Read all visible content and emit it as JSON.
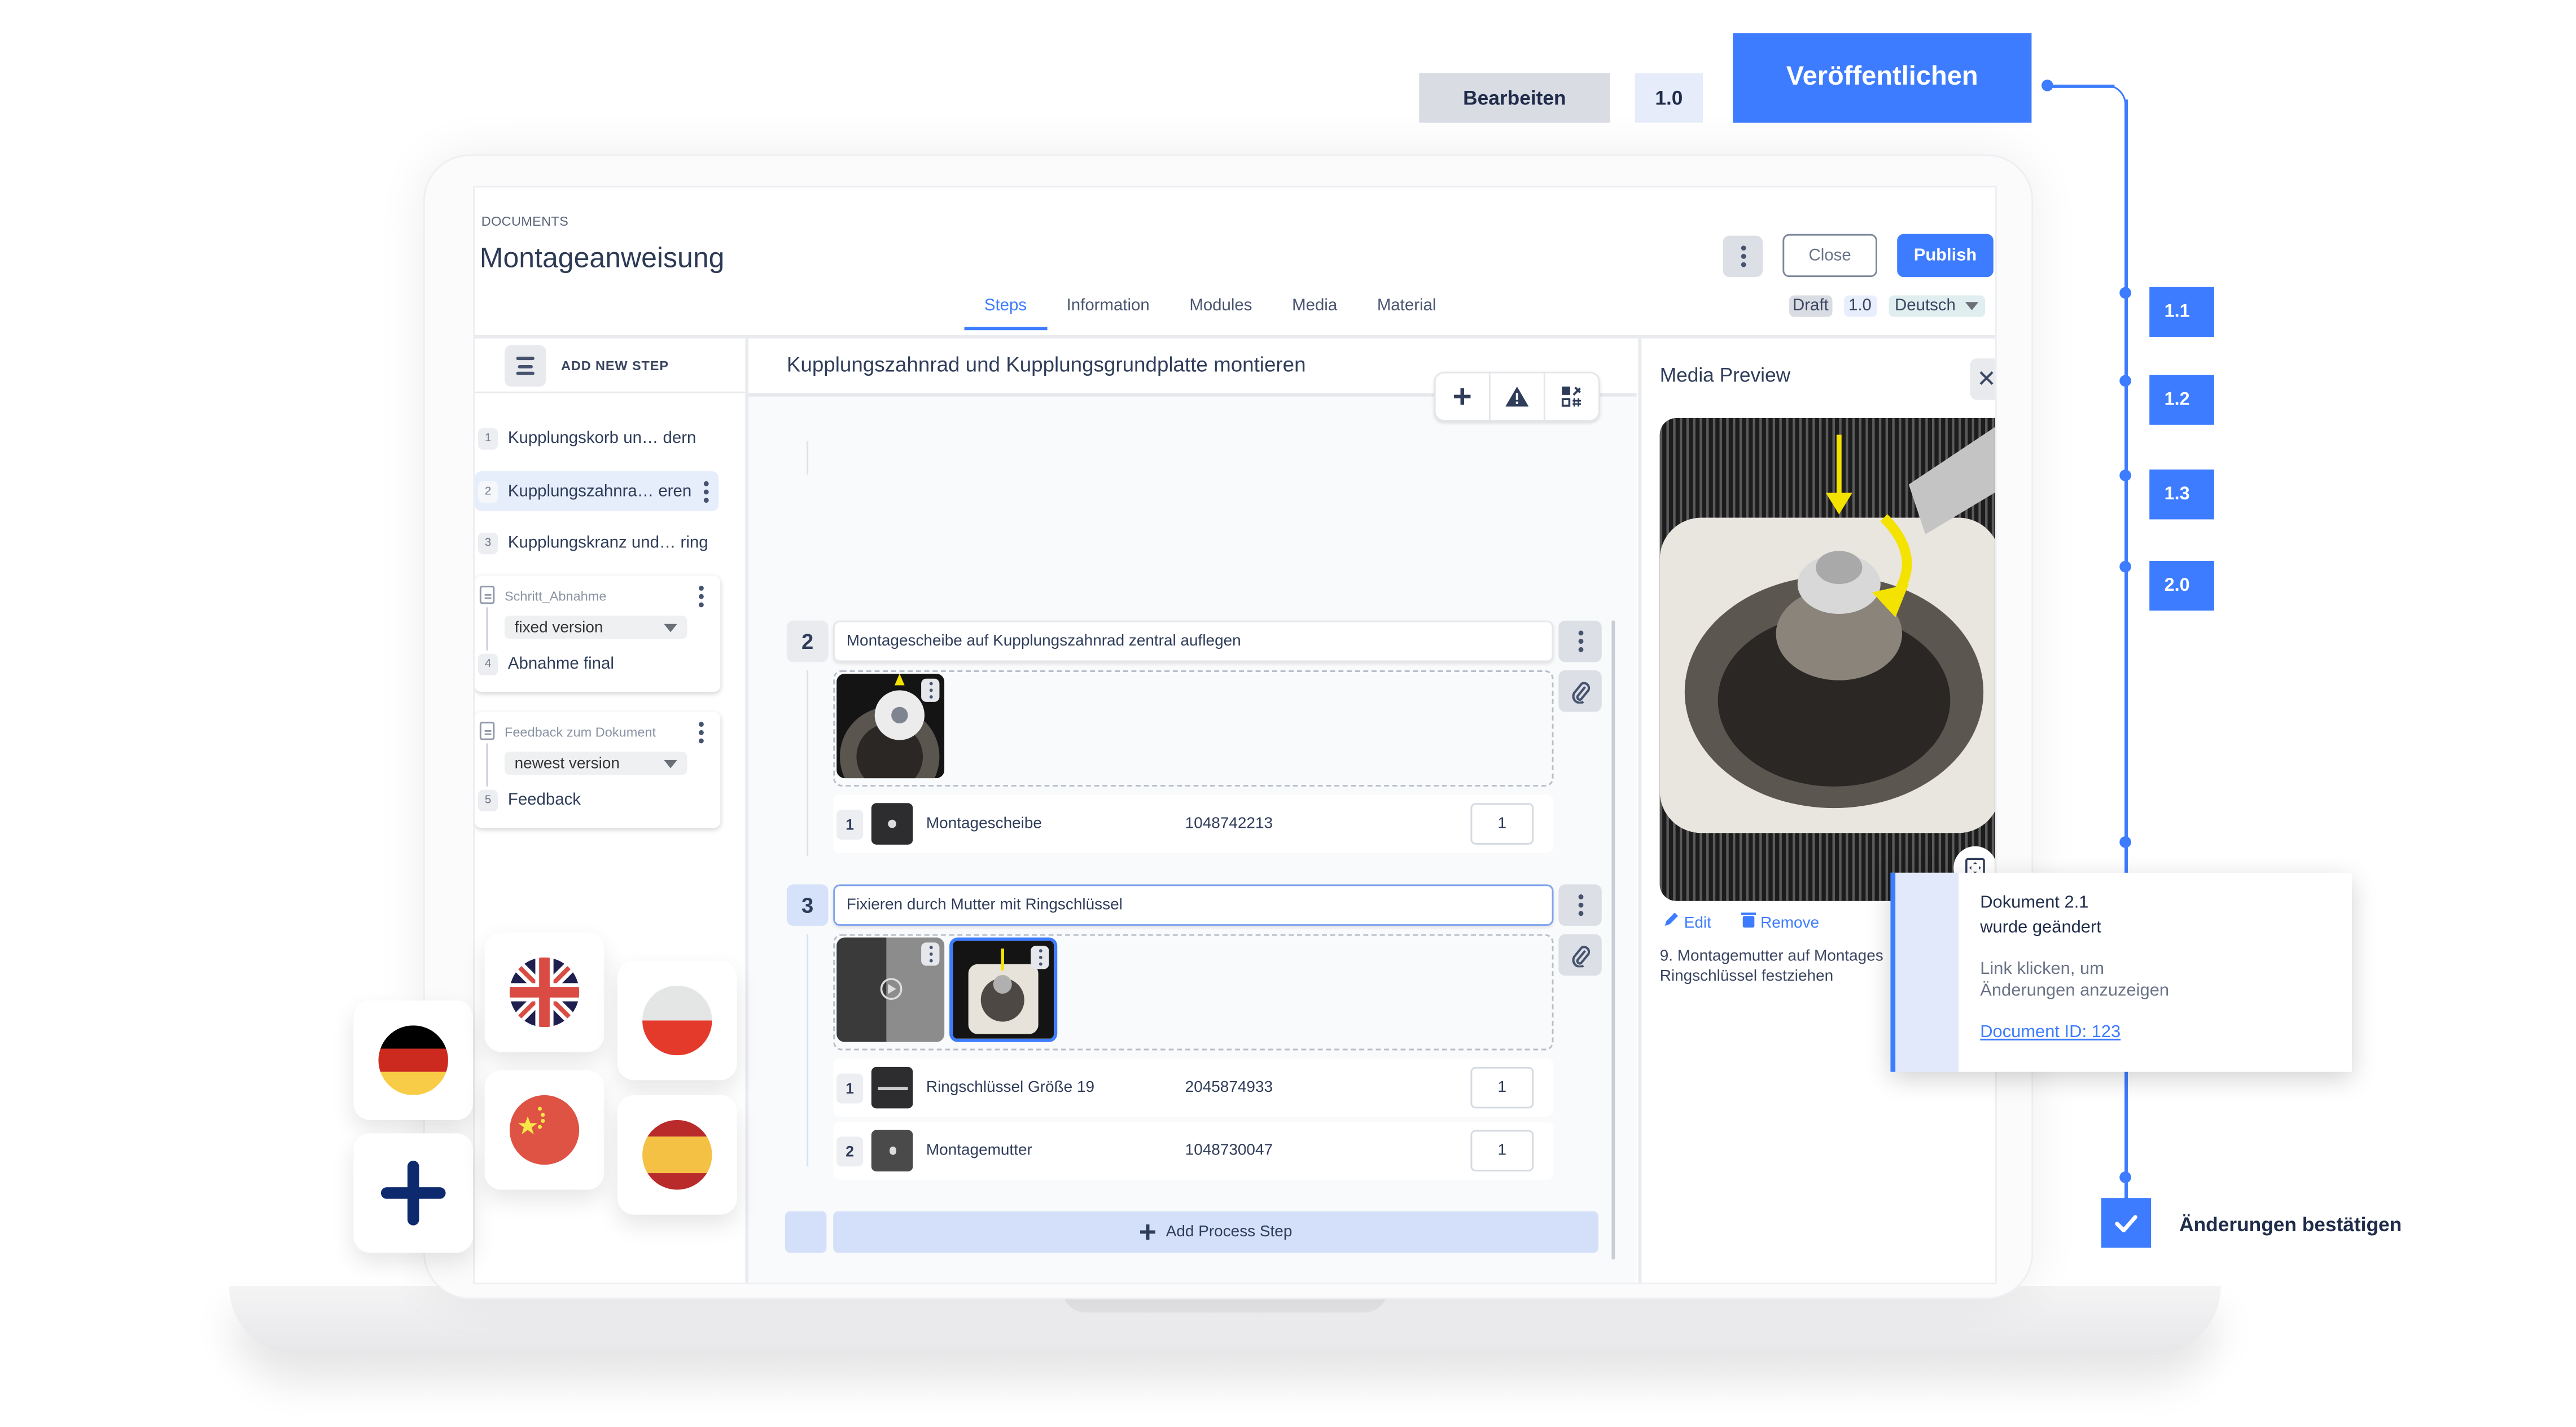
{
  "overlay": {
    "edit_label": "Bearbeiten",
    "version_label": "1.0",
    "publish_label": "Veröffentlichen",
    "version_history": [
      "1.1",
      "1.2",
      "1.3",
      "2.0"
    ],
    "notification": {
      "title_line1": "Dokument 2.1",
      "title_line2": "wurde geändert",
      "sub_line1": "Link klicken, um",
      "sub_line2": "Änderungen anzuzeigen",
      "link": "Document ID: 123"
    },
    "confirm_label": "Änderungen bestätigen",
    "languages": [
      "German",
      "English (UK)",
      "Polish",
      "Chinese",
      "Spanish",
      "Add language"
    ]
  },
  "header": {
    "breadcrumb": "DOCUMENTS",
    "title": "Montageanweisung",
    "close_label": "Close",
    "publish_label": "Publish",
    "status": "Draft",
    "version": "1.0",
    "language": "Deutsch",
    "tabs": [
      {
        "label": "Steps",
        "active": true
      },
      {
        "label": "Information",
        "active": false
      },
      {
        "label": "Modules",
        "active": false
      },
      {
        "label": "Media",
        "active": false
      },
      {
        "label": "Material",
        "active": false
      }
    ]
  },
  "sidebar": {
    "add_step_label": "ADD NEW STEP",
    "steps": [
      {
        "num": "1",
        "label": "Kupplungskorb un… dern"
      },
      {
        "num": "2",
        "label": "Kupplungszahnra… eren",
        "active": true
      },
      {
        "num": "3",
        "label": "Kupplungskranz und… ring"
      }
    ],
    "modules": [
      {
        "title": "Schritt_Abnahme",
        "version": "fixed version",
        "num": "4",
        "step": "Abnahme final"
      },
      {
        "title": "Feedback zum Dokument",
        "version": "newest version",
        "num": "5",
        "step": "Feedback"
      }
    ]
  },
  "main": {
    "step_title": "Kupplungszahnrad und Kupplungsgrundplatte montieren",
    "substeps": [
      {
        "num": "2",
        "text": "Montagescheibe auf Kupplungszahnrad zentral auflegen",
        "materials": [
          {
            "num": "1",
            "name": "Montagescheibe",
            "id": "1048742213",
            "qty": "1"
          }
        ]
      },
      {
        "num": "3",
        "text": "Fixieren durch Mutter mit Ringschlüssel",
        "materials": [
          {
            "num": "1",
            "name": "Ringschlüssel Größe 19",
            "id": "2045874933",
            "qty": "1"
          },
          {
            "num": "2",
            "name": "Montagemutter",
            "id": "1048730047",
            "qty": "1"
          }
        ]
      }
    ],
    "add_process_step_label": "Add Process Step"
  },
  "preview": {
    "title": "Media Preview",
    "edit_label": "Edit",
    "remove_label": "Remove",
    "caption_line1": "9. Montagemutter auf Montages",
    "caption_line2": "Ringschlüssel festziehen"
  },
  "colors": {
    "accent": "#3d7cff",
    "text": "#2f3d5a",
    "active_bg": "#e6eefc"
  }
}
